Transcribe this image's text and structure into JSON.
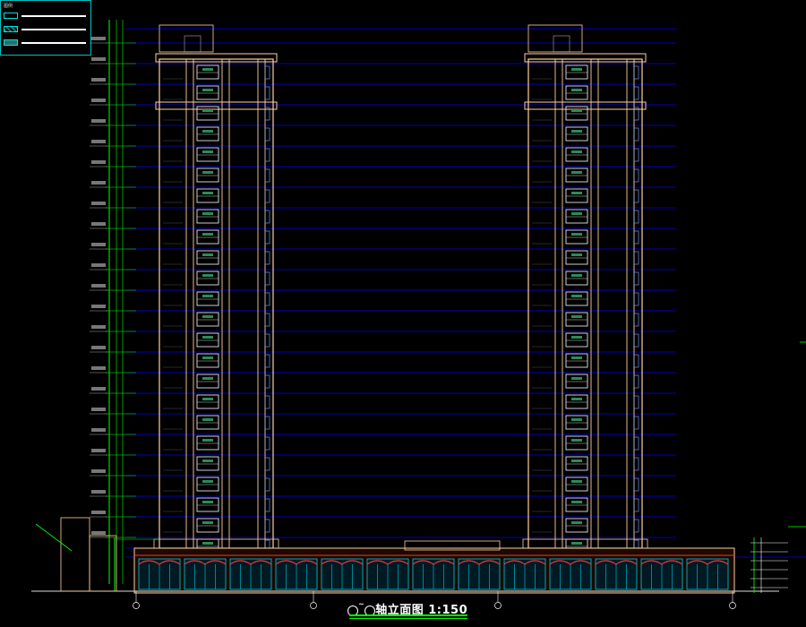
{
  "drawing": {
    "title_text": "轴立面图",
    "title_scale": "1:150",
    "axis_start": "",
    "axis_end": ""
  },
  "legend": {
    "title": "图例",
    "rows": [
      {
        "name": "legend-row-1",
        "swatch": "outline"
      },
      {
        "name": "legend-row-2",
        "swatch": "hatched"
      },
      {
        "name": "legend-row-3",
        "swatch": "filled"
      }
    ]
  },
  "colors": {
    "background": "#000000",
    "level_line": "#0000ff",
    "building_outline": "#ffd0a0",
    "window": "#ffffff",
    "podium_glass": "#00c8e0",
    "podium_red": "#ff3030",
    "dimension": "#00ff00",
    "annotation": "#ffffff"
  },
  "annotations": {
    "roof_label_left": "",
    "roof_label_right": "",
    "podium_label": "",
    "ground_label": ""
  }
}
